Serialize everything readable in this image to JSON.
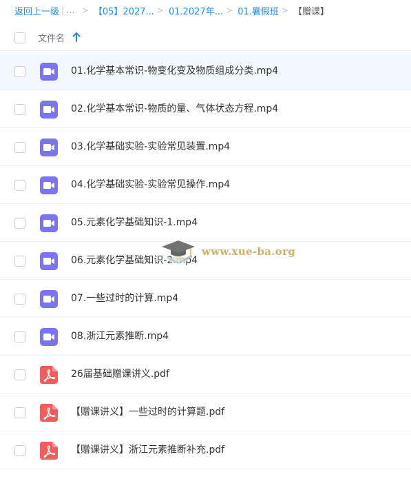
{
  "breadcrumb": {
    "back_label": "返回上一级",
    "separator": "|",
    "ellipsis": "...",
    "arrow": ">",
    "items": [
      "【05】2027...",
      "01.2027年...",
      "01.暑假班"
    ],
    "current": "【赠课】"
  },
  "header": {
    "column_label": "文件名"
  },
  "files": [
    {
      "name": "01.化学基本常识-物变化变及物质组成分类.mp4",
      "type": "video"
    },
    {
      "name": "02.化学基本常识-物质的量、气体状态方程.mp4",
      "type": "video"
    },
    {
      "name": "03.化学基础实验-实验常见装置.mp4",
      "type": "video"
    },
    {
      "name": "04.化学基础实验-实验常见操作.mp4",
      "type": "video"
    },
    {
      "name": "05.元素化学基础知识-1.mp4",
      "type": "video"
    },
    {
      "name": "06.元素化学基础知识-2.mp4",
      "type": "video"
    },
    {
      "name": "07.一些过时的计算.mp4",
      "type": "video"
    },
    {
      "name": "08.浙江元素推断.mp4",
      "type": "video"
    },
    {
      "name": "26届基础赠课讲义.pdf",
      "type": "pdf"
    },
    {
      "name": "【赠课讲义】一些过时的计算题.pdf",
      "type": "pdf"
    },
    {
      "name": "【赠课讲义】浙江元素推断补充.pdf",
      "type": "pdf"
    }
  ],
  "watermark": {
    "text": "www.xue-ba.org"
  },
  "colors": {
    "link": "#1a8cff",
    "video_icon": "#7b74f0",
    "pdf_icon": "#f25c5c",
    "selected_row": "#f2f8fd"
  }
}
